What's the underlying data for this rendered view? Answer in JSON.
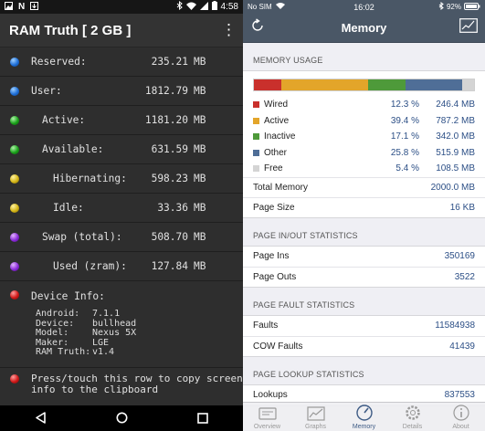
{
  "android": {
    "status": {
      "time": "4:58"
    },
    "title": "RAM Truth  [ 2 GB ]",
    "rows": [
      {
        "label": "Reserved:",
        "value": "235.21",
        "unit": "MB",
        "color": "#1e6fd8"
      },
      {
        "label": "User:",
        "value": "1812.79",
        "unit": "MB",
        "color": "#1e6fd8"
      },
      {
        "label": "Active:",
        "value": "1181.20",
        "unit": "MB",
        "color": "#1aa11a"
      },
      {
        "label": "Available:",
        "value": "631.59",
        "unit": "MB",
        "color": "#1aa11a"
      },
      {
        "label": "Hibernating:",
        "value": "598.23",
        "unit": "MB",
        "color": "#d4b516"
      },
      {
        "label": "Idle:",
        "value": "33.36",
        "unit": "MB",
        "color": "#d4b516"
      },
      {
        "label": "Swap (total):",
        "value": "508.70",
        "unit": "MB",
        "color": "#8a2bd8"
      },
      {
        "label": "Used (zram):",
        "value": "127.84",
        "unit": "MB",
        "color": "#8a2bd8"
      }
    ],
    "device_info": {
      "label": "Device Info:",
      "items": [
        {
          "k": "Android:",
          "v": "7.1.1"
        },
        {
          "k": "Device:",
          "v": "bullhead"
        },
        {
          "k": "Model:",
          "v": "Nexus 5X"
        },
        {
          "k": "Maker:",
          "v": "LGE"
        },
        {
          "k": "RAM Truth:",
          "v": "v1.4"
        }
      ]
    },
    "press_text": "Press/touch this row to copy screen info to the clipboard"
  },
  "ios": {
    "status": {
      "carrier": "No SIM",
      "time": "16:02",
      "battery": "92%"
    },
    "nav_title": "Memory",
    "memory_usage": {
      "header": "MEMORY USAGE",
      "segments": [
        {
          "name": "Wired",
          "percent": "12.3 %",
          "mb": "246.4 MB",
          "fraction": 0.123,
          "color": "#c9302c"
        },
        {
          "name": "Active",
          "percent": "39.4 %",
          "mb": "787.2 MB",
          "fraction": 0.394,
          "color": "#e3a52a"
        },
        {
          "name": "Inactive",
          "percent": "17.1 %",
          "mb": "342.0 MB",
          "fraction": 0.171,
          "color": "#4e9a3a"
        },
        {
          "name": "Other",
          "percent": "25.8 %",
          "mb": "515.9 MB",
          "fraction": 0.258,
          "color": "#4f6e97"
        },
        {
          "name": "Free",
          "percent": "5.4 %",
          "mb": "108.5 MB",
          "fraction": 0.054,
          "color": "#d4d4d4"
        }
      ],
      "total_label": "Total Memory",
      "total_value": "2000.0 MB",
      "page_size_label": "Page Size",
      "page_size_value": "16 KB"
    },
    "page_inout": {
      "header": "PAGE IN/OUT STATISTICS",
      "rows": [
        {
          "label": "Page Ins",
          "value": "350169"
        },
        {
          "label": "Page Outs",
          "value": "3522"
        }
      ]
    },
    "page_fault": {
      "header": "PAGE FAULT STATISTICS",
      "rows": [
        {
          "label": "Faults",
          "value": "11584938"
        },
        {
          "label": "COW Faults",
          "value": "41439"
        }
      ]
    },
    "page_lookup": {
      "header": "PAGE LOOKUP STATISTICS",
      "partial_label": "Lookups",
      "partial_value": "837553"
    },
    "tabs": [
      {
        "label": "Overview",
        "icon": "overview-icon"
      },
      {
        "label": "Graphs",
        "icon": "graphs-icon"
      },
      {
        "label": "Memory",
        "icon": "memory-gauge-icon",
        "selected": true
      },
      {
        "label": "Details",
        "icon": "gear-icon"
      },
      {
        "label": "About",
        "icon": "info-icon"
      }
    ]
  }
}
